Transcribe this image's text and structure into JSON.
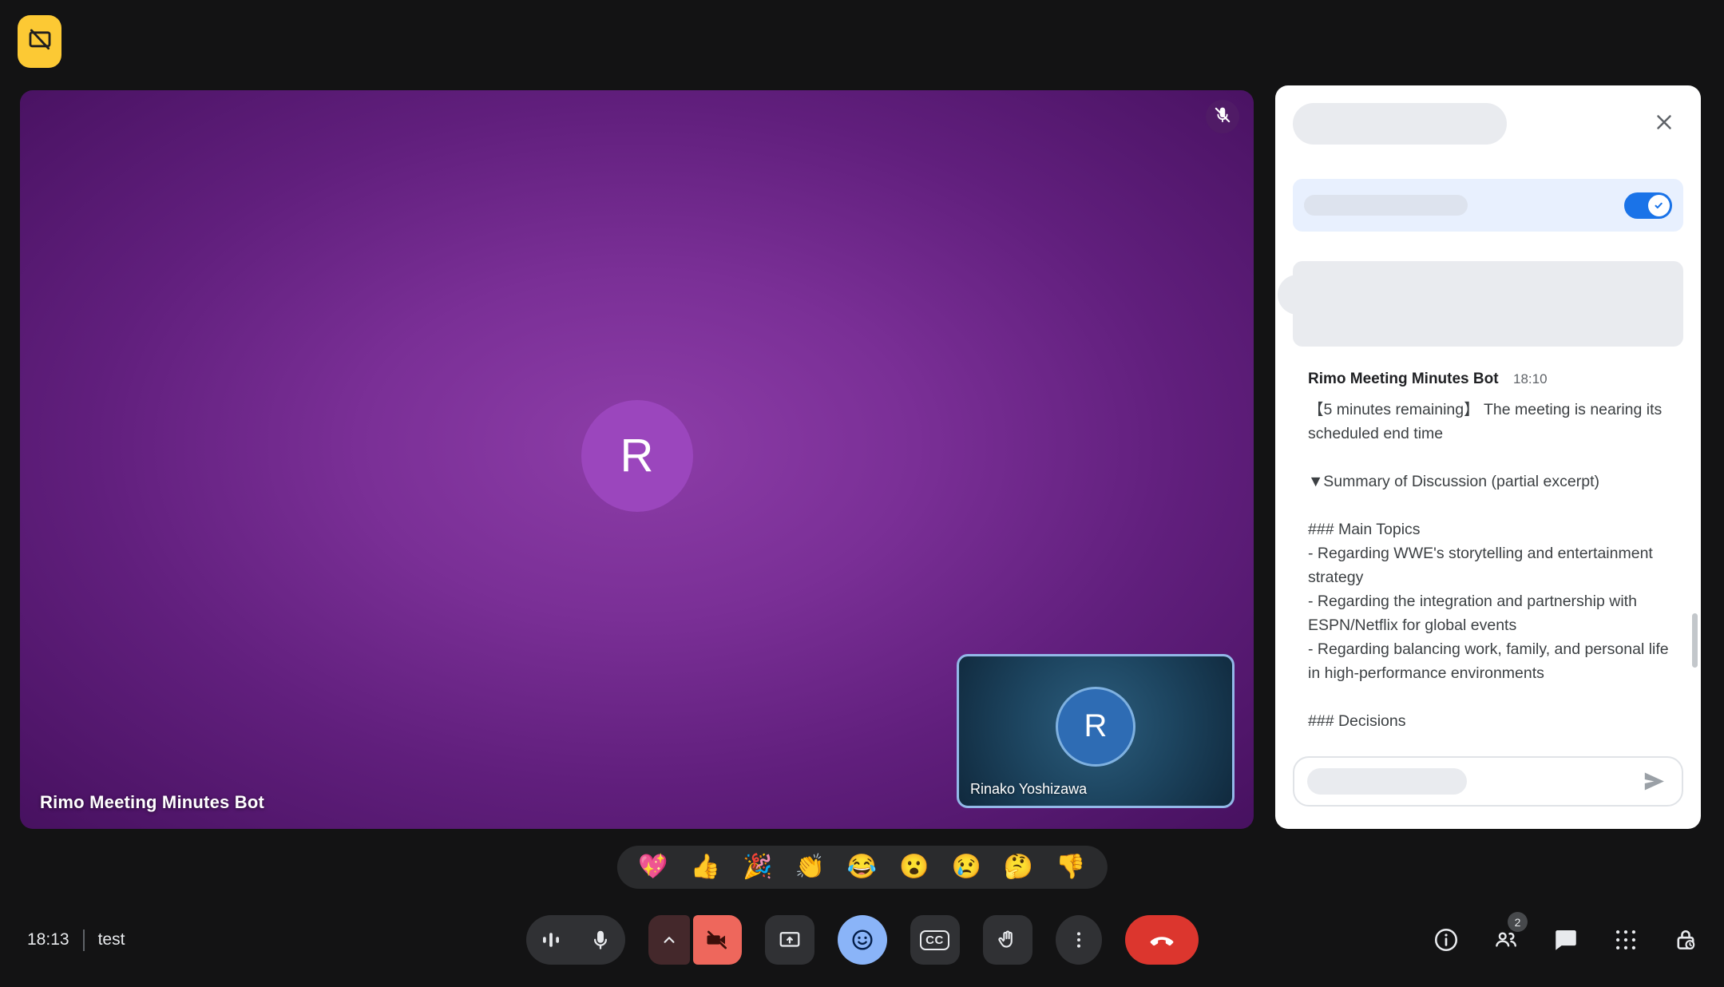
{
  "colors": {
    "accent_blue": "#1a73e8",
    "reactions_active_blue": "#8ab4f8",
    "end_call_red": "#dc362e",
    "camera_off_red": "#ee675c",
    "badge_yellow": "#fcc934",
    "main_tile_purple": "#7a2f96",
    "self_tile_blue": "#1d4560"
  },
  "top_badge": {
    "icon": "presentation-off-icon"
  },
  "main_tile": {
    "name": "Rimo Meeting Minutes Bot",
    "avatar_letter": "R",
    "mic_muted": true
  },
  "self_tile": {
    "name": "Rinako Yoshizawa",
    "avatar_letter": "R"
  },
  "chat": {
    "message": {
      "sender": "Rimo Meeting Minutes Bot",
      "time": "18:10",
      "lines": [
        "【5 minutes remaining】 The meeting is nearing its scheduled end time",
        "▼Summary of Discussion (partial excerpt)",
        "### Main Topics",
        "- Regarding WWE's storytelling and entertainment strategy",
        "- Regarding the integration and partnership with ESPN/Netflix for global events",
        "- Regarding balancing work, family, and personal life in high-performance environments",
        "### Decisions"
      ]
    }
  },
  "reactions": [
    "💖",
    "👍",
    "🎉",
    "👏",
    "😂",
    "😮",
    "😢",
    "🤔",
    "👎"
  ],
  "controls": {
    "cc_label": "CC"
  },
  "bottom_bar": {
    "time": "18:13",
    "meeting_name": "test",
    "participants_badge": "2"
  }
}
